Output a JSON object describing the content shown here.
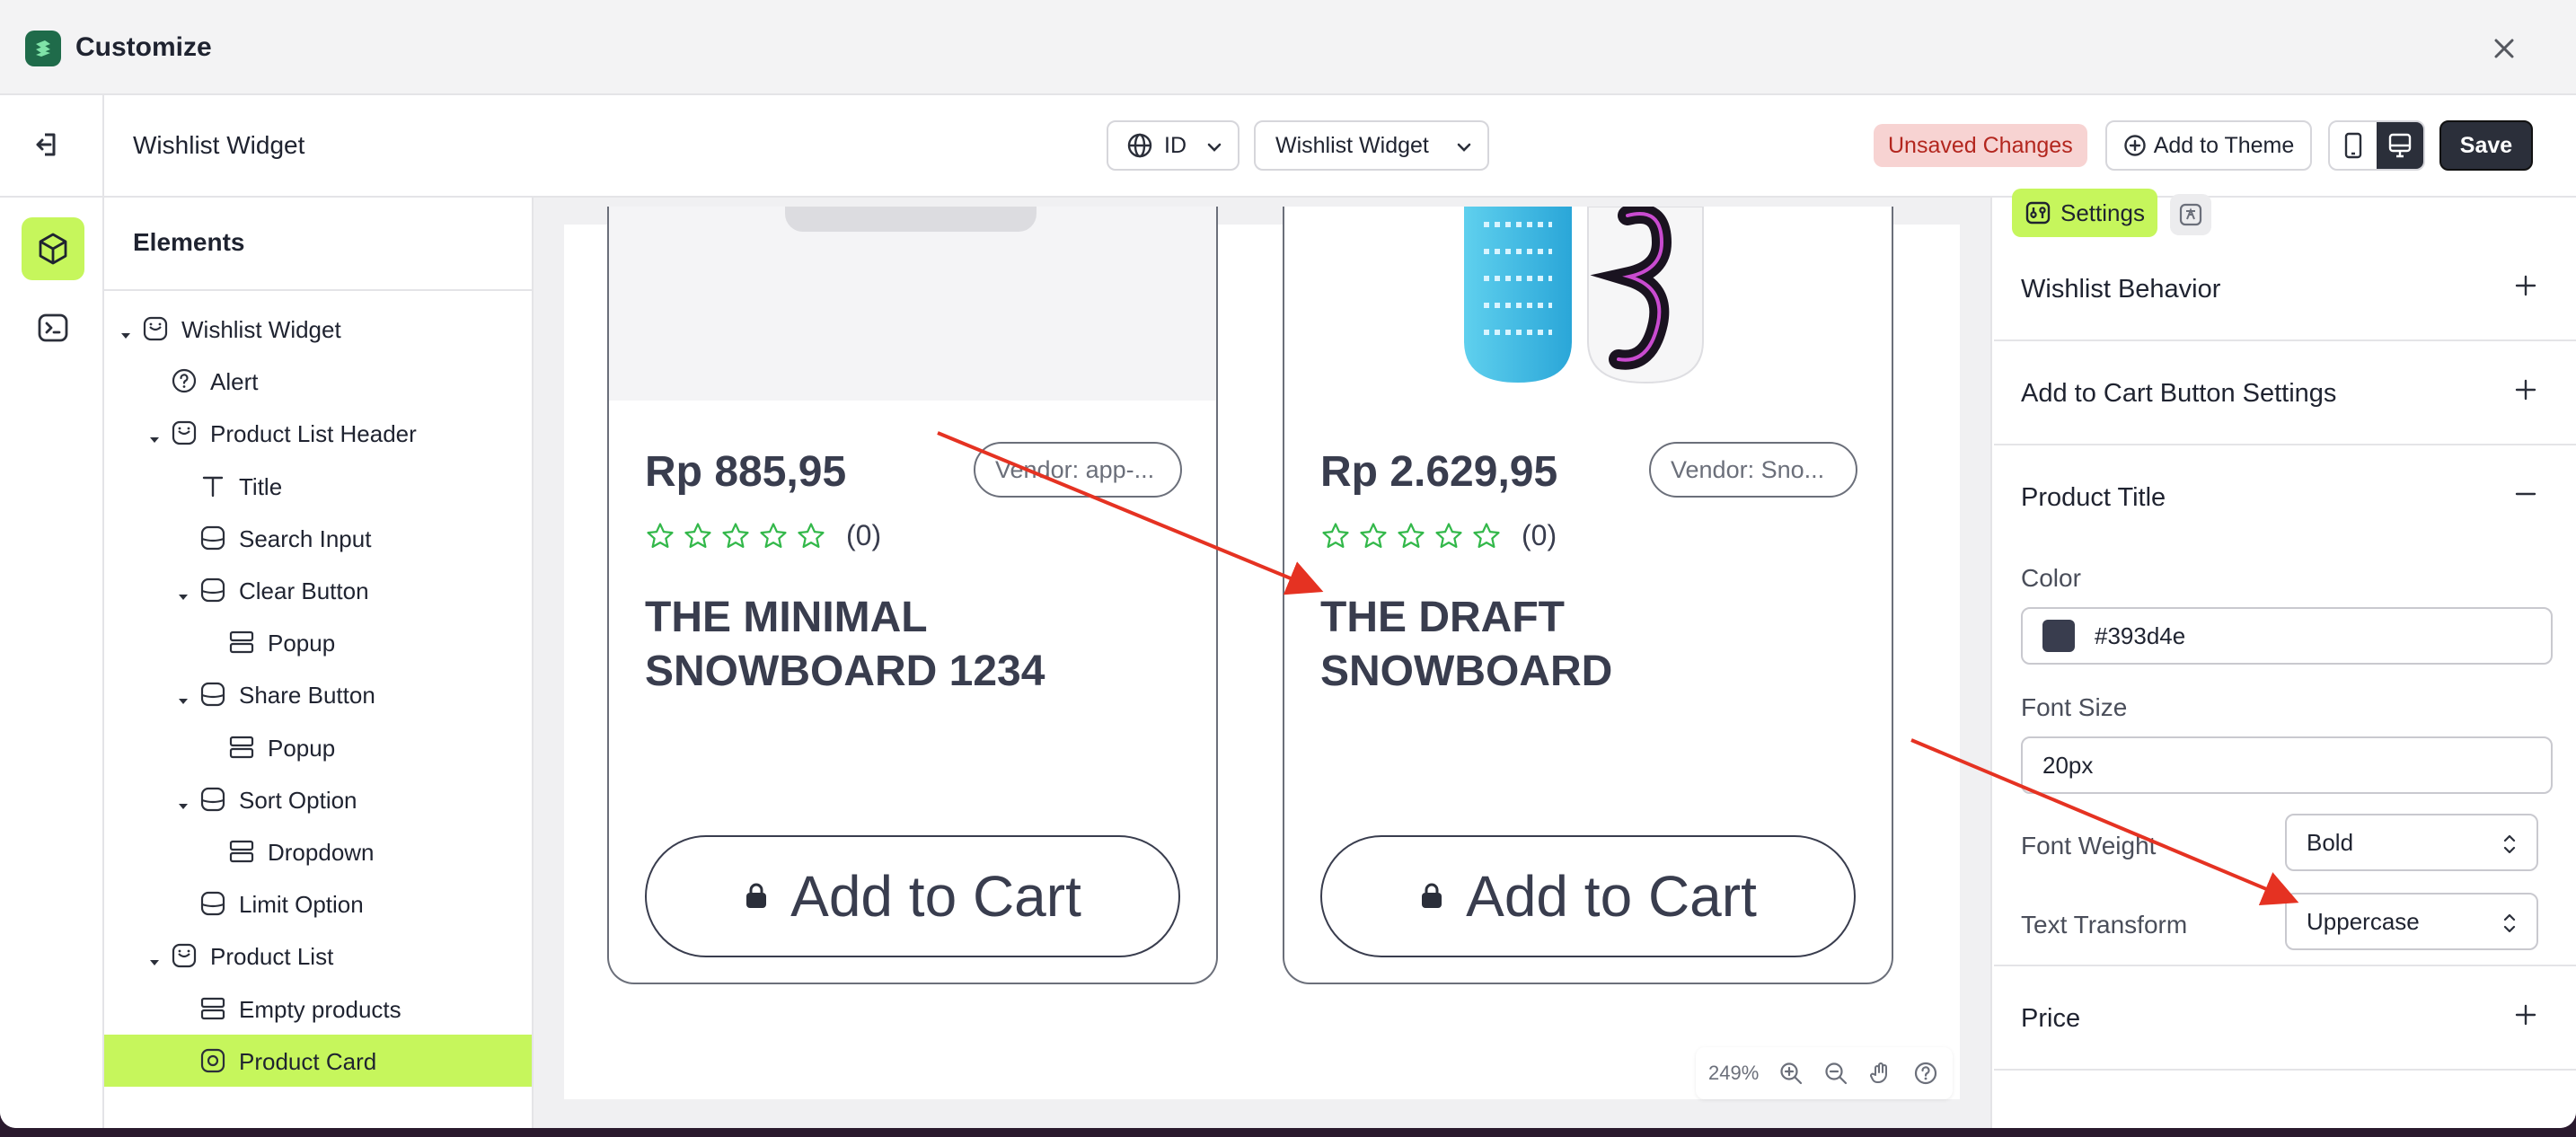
{
  "app": {
    "title": "Customize"
  },
  "toolbar": {
    "page_title": "Wishlist Widget",
    "language": "ID",
    "page_selector": "Wishlist Widget",
    "unsaved_label": "Unsaved Changes",
    "add_theme_label": "Add to Theme",
    "save_label": "Save"
  },
  "elements_panel": {
    "title": "Elements",
    "items": [
      {
        "label": "Wishlist Widget",
        "icon": "widget-icon",
        "caret": true
      },
      {
        "label": "Alert",
        "icon": "question-circle-icon",
        "caret": false
      },
      {
        "label": "Product List Header",
        "icon": "widget-icon",
        "caret": true
      },
      {
        "label": "Title",
        "icon": "text-icon",
        "caret": false
      },
      {
        "label": "Search Input",
        "icon": "block-icon",
        "caret": false
      },
      {
        "label": "Clear Button",
        "icon": "block-icon",
        "caret": true
      },
      {
        "label": "Popup",
        "icon": "layout-icon",
        "caret": false
      },
      {
        "label": "Share Button",
        "icon": "block-icon",
        "caret": true
      },
      {
        "label": "Popup",
        "icon": "layout-icon",
        "caret": false
      },
      {
        "label": "Sort Option",
        "icon": "block-icon",
        "caret": true
      },
      {
        "label": "Dropdown",
        "icon": "layout-icon",
        "caret": false
      },
      {
        "label": "Limit Option",
        "icon": "block-icon",
        "caret": false
      },
      {
        "label": "Product List",
        "icon": "widget-icon",
        "caret": true
      },
      {
        "label": "Empty products",
        "icon": "layout-icon",
        "caret": false
      },
      {
        "label": "Product Card",
        "icon": "card-icon",
        "caret": false,
        "selected": true
      }
    ]
  },
  "preview": {
    "cards": [
      {
        "price": "Rp 885,95",
        "vendor": "Vendor: app-...",
        "rating_count": "(0)",
        "title": "The Minimal Snowboard 1234",
        "cta": "Add to Cart"
      },
      {
        "price": "Rp 2.629,95",
        "vendor": "Vendor: Sno...",
        "rating_count": "(0)",
        "title": "The Draft Snowboard",
        "cta": "Add to Cart"
      }
    ],
    "zoom": "249%"
  },
  "settings_panel": {
    "tab_label": "Settings",
    "sections": {
      "wishlist_behavior": "Wishlist Behavior",
      "add_to_cart": "Add to Cart Button Settings",
      "product_title": "Product Title",
      "price": "Price"
    },
    "product_title": {
      "color_label": "Color",
      "color_value": "#393d4e",
      "font_size_label": "Font Size",
      "font_size_value": "20px",
      "font_weight_label": "Font Weight",
      "font_weight_value": "Bold",
      "text_transform_label": "Text Transform",
      "text_transform_value": "Uppercase"
    }
  },
  "colors": {
    "accent": "#c6f65c",
    "title_color": "#393d4e",
    "annotation_arrow": "#e53222",
    "unsaved_bg": "#f7d3d2"
  }
}
